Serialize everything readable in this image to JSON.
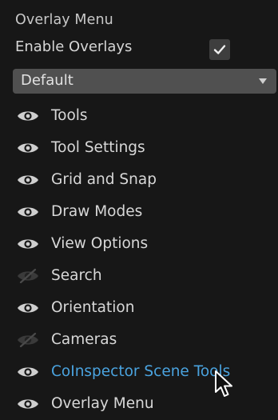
{
  "menu": {
    "title": "Overlay Menu",
    "enable_label": "Enable Overlays",
    "enable_checked": true,
    "preset": "Default"
  },
  "items": [
    {
      "label": "Tools",
      "visible": true
    },
    {
      "label": "Tool Settings",
      "visible": true
    },
    {
      "label": "Grid and Snap",
      "visible": true
    },
    {
      "label": "Draw Modes",
      "visible": true
    },
    {
      "label": "View Options",
      "visible": true
    },
    {
      "label": "Search",
      "visible": false
    },
    {
      "label": "Orientation",
      "visible": true
    },
    {
      "label": "Cameras",
      "visible": false
    },
    {
      "label": "CoInspector Scene Tools",
      "visible": true
    },
    {
      "label": "Overlay Menu",
      "visible": true
    }
  ],
  "colors": {
    "background": "#171717",
    "text": "#d8d8d8",
    "highlight": "#4aa3df",
    "dropdown": "#505050"
  },
  "icons": {
    "visible": "eye-icon",
    "hidden": "eye-slash-icon",
    "check": "checkmark-icon",
    "dropdown": "triangle-down-icon",
    "pointer": "mouse-cursor-icon"
  }
}
